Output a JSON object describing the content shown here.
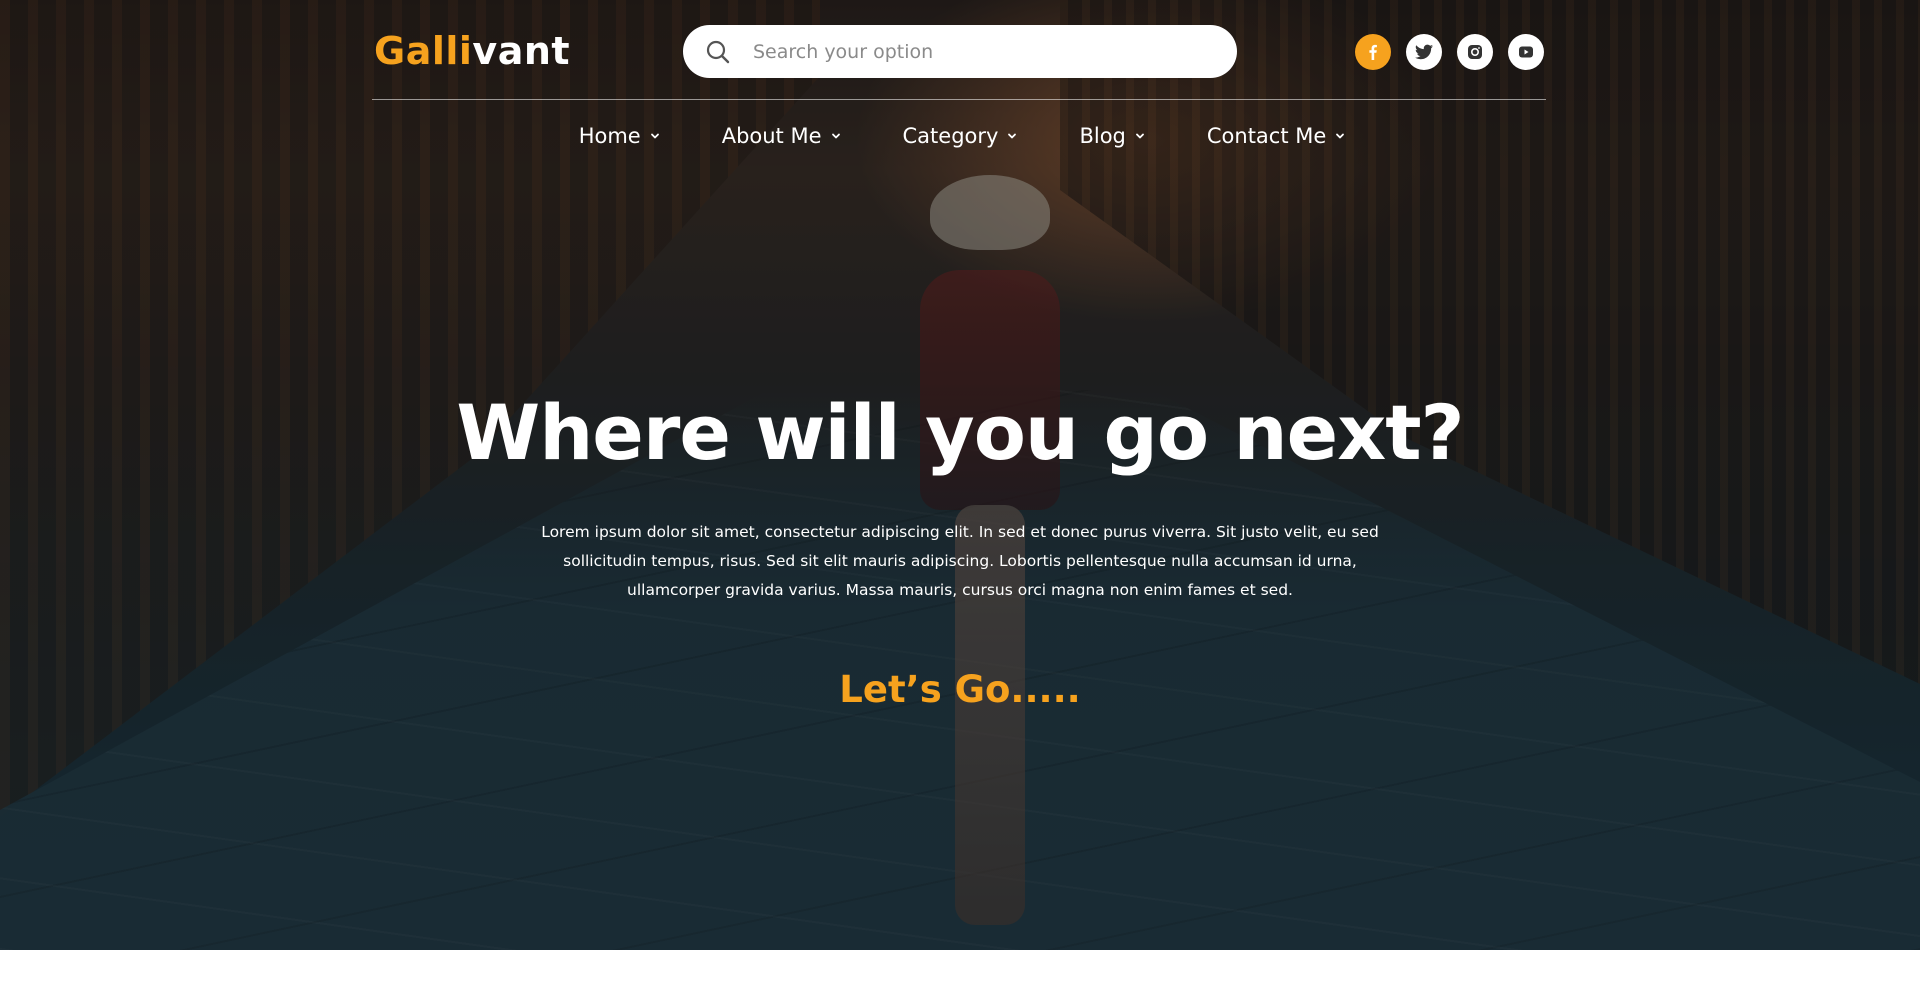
{
  "brand": {
    "name_part1": "Galli",
    "name_part2": "vant",
    "accent_color": "#f6a21e"
  },
  "search": {
    "placeholder": "Search your option",
    "value": "",
    "icon": "search-icon"
  },
  "socials": [
    {
      "name": "facebook",
      "icon": "facebook-icon",
      "active": true
    },
    {
      "name": "twitter",
      "icon": "twitter-icon",
      "active": false
    },
    {
      "name": "instagram",
      "icon": "instagram-icon",
      "active": false
    },
    {
      "name": "youtube",
      "icon": "youtube-icon",
      "active": false
    }
  ],
  "nav": {
    "items": [
      {
        "label": "Home",
        "icon": "chevron-down-icon"
      },
      {
        "label": "About Me",
        "icon": "chevron-down-icon"
      },
      {
        "label": "Category",
        "icon": "chevron-down-icon"
      },
      {
        "label": "Blog",
        "icon": "chevron-down-icon"
      },
      {
        "label": "Contact Me",
        "icon": "chevron-down-icon"
      }
    ]
  },
  "hero": {
    "headline": "Where will you go next?",
    "lead": "Lorem ipsum dolor sit amet, consectetur adipiscing elit. In sed et donec purus viverra. Sit justo velit, eu sed sollicitudin tempus, risus. Sed sit elit mauris adipiscing. Lobortis pellentesque nulla accumsan id urna, ullamcorper gravida varius. Massa mauris, cursus orci magna non enim fames et sed.",
    "cta": "Let’s Go....."
  },
  "colors": {
    "accent": "#f6a21e",
    "text_light": "#ffffff"
  }
}
